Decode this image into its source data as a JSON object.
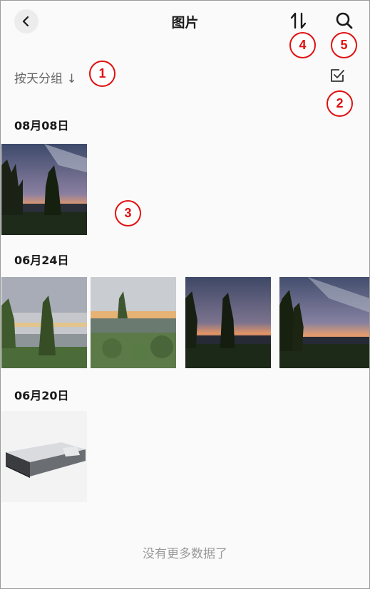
{
  "header": {
    "title": "图片",
    "back_icon": "chevron-left-icon",
    "sort_icon": "sort-icon",
    "search_icon": "search-icon"
  },
  "toolbar": {
    "group_label": "按天分组 ↓",
    "select_icon": "checkbox-icon"
  },
  "callouts": [
    "1",
    "2",
    "3",
    "4",
    "5"
  ],
  "groups": [
    {
      "date": "08月08日",
      "photos": [
        "sunset-lake"
      ]
    },
    {
      "date": "06月24日",
      "photos": [
        "cloudy-lake",
        "lotus-pond",
        "dusk-lake",
        "dusk-lake-wide"
      ]
    },
    {
      "date": "06月20日",
      "photos": [
        "device-box"
      ]
    }
  ],
  "footer": {
    "text": "没有更多数据了"
  },
  "colors": {
    "callout": "#e01010",
    "accent_text": "#1a1a1a",
    "muted_text": "#9a9a9a"
  }
}
